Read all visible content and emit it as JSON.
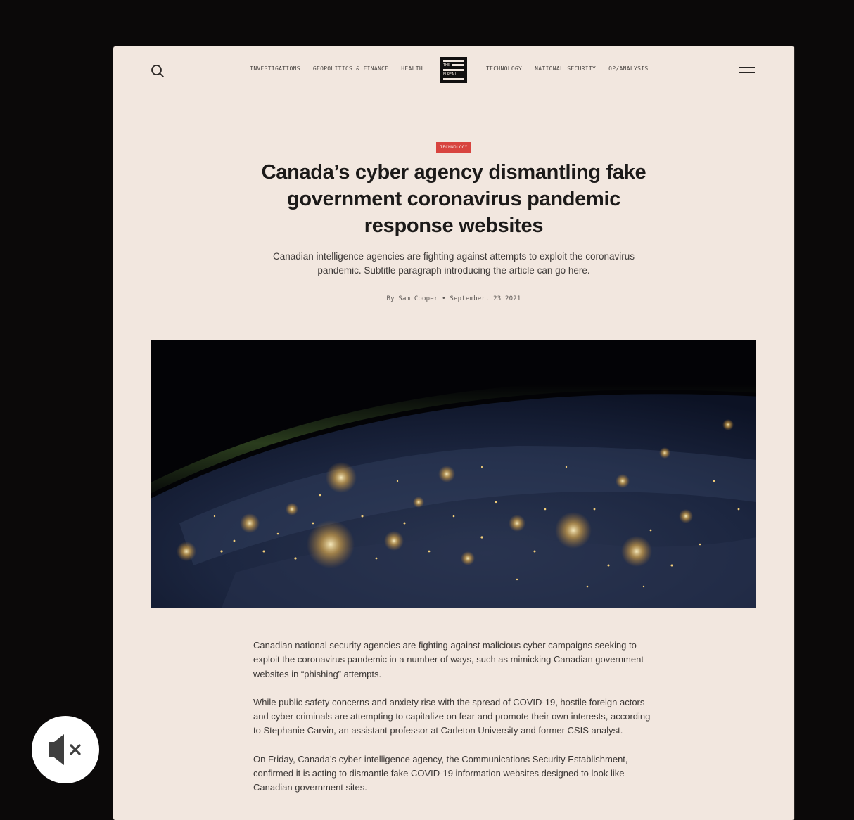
{
  "nav": {
    "left_links": [
      "INVESTIGATIONS",
      "GEOPOLITICS & FINANCE",
      "HEALTH"
    ],
    "right_links": [
      "TECHNOLOGY",
      "NATIONAL SECURITY",
      "OP/ANALYSIS"
    ],
    "logo_text": [
      "THE",
      "BUREAU"
    ]
  },
  "article": {
    "category": "TECHNOLOGY",
    "title": "Canada’s cyber agency dismantling fake government coronavirus pandemic response websites",
    "subtitle": "Canadian intelligence agencies are fighting against attempts to exploit the coronavirus pandemic. Subtitle paragraph introducing the article can go here.",
    "byline": "By Sam Cooper • September. 23 2021",
    "paragraphs": [
      "Canadian national security agencies are fighting against malicious cyber campaigns seeking to exploit the coronavirus pandemic in a number of ways, such as mimicking Canadian government websites in “phishing” attempts.",
      "While public safety concerns and anxiety rise with the spread of COVID-19, hostile foreign actors and cyber criminals are attempting to capitalize on fear and promote their own interests, according to Stephanie Carvin, an assistant professor at Carleton University and former CSIS analyst.",
      "On Friday, Canada’s cyber-intelligence agency, the Communications Security Establishment, confirmed it is acting to dismantle fake COVID-19 information websites designed to look like Canadian government sites."
    ]
  },
  "icons": {
    "search": "search-icon",
    "menu": "hamburger-menu-icon",
    "mute": "speaker-muted-icon"
  },
  "colors": {
    "page_bg": "#f2e7df",
    "outer_bg": "#0b0909",
    "accent": "#d8443f",
    "text": "#1c1a19"
  }
}
